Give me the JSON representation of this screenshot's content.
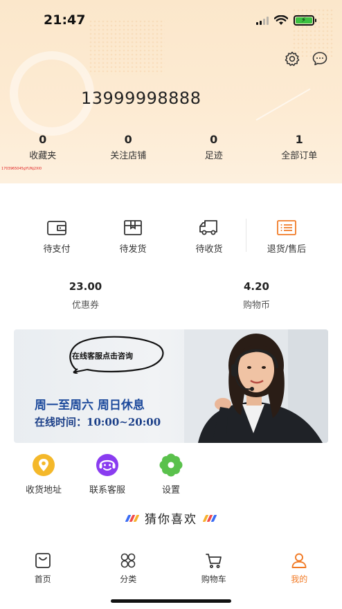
{
  "status_bar": {
    "time": "21:47",
    "battery_color": "#3cc141"
  },
  "header": {
    "phone_number": "13999998888",
    "settings_icon": "gear-icon",
    "message_icon": "chat-bubble-icon",
    "stats": [
      {
        "value": "0",
        "label": "收藏夹"
      },
      {
        "value": "0",
        "label": "关注店铺"
      },
      {
        "value": "0",
        "label": "足迹"
      },
      {
        "value": "1",
        "label": "全部订单"
      }
    ],
    "tiny_id": "1703965045gYUNj2Xl0"
  },
  "orders": [
    {
      "label": "待支付",
      "icon": "wallet-icon"
    },
    {
      "label": "待发货",
      "icon": "package-icon"
    },
    {
      "label": "待收货",
      "icon": "truck-icon"
    },
    {
      "label": "退货/售后",
      "icon": "return-list-icon",
      "color": "#f17a25"
    }
  ],
  "wallet": [
    {
      "value": "23.00",
      "label": "优惠券"
    },
    {
      "value": "4.20",
      "label": "购物币"
    }
  ],
  "banner": {
    "bubble_text": "在线客服点击咨询",
    "line1": "周一至周六 周日休息",
    "line2": "在线时间：10:00~20:00"
  },
  "services": [
    {
      "label": "收货地址",
      "icon": "location-icon",
      "color": "#f4b82a"
    },
    {
      "label": "联系客服",
      "icon": "customer-service-icon",
      "color": "#8a3cf0"
    },
    {
      "label": "设置",
      "icon": "settings-flower-icon",
      "color": "#5ac14c"
    }
  ],
  "guess": {
    "title": "猜你喜欢"
  },
  "tabbar": [
    {
      "label": "首页",
      "icon": "home-bag-icon",
      "active": false
    },
    {
      "label": "分类",
      "icon": "category-icon",
      "active": false
    },
    {
      "label": "购物车",
      "icon": "cart-icon",
      "active": false
    },
    {
      "label": "我的",
      "icon": "user-icon",
      "active": true
    }
  ],
  "colors": {
    "accent": "#f17a25",
    "header_bg": "#fbe7cb",
    "banner_text": "#1d4a9c"
  }
}
